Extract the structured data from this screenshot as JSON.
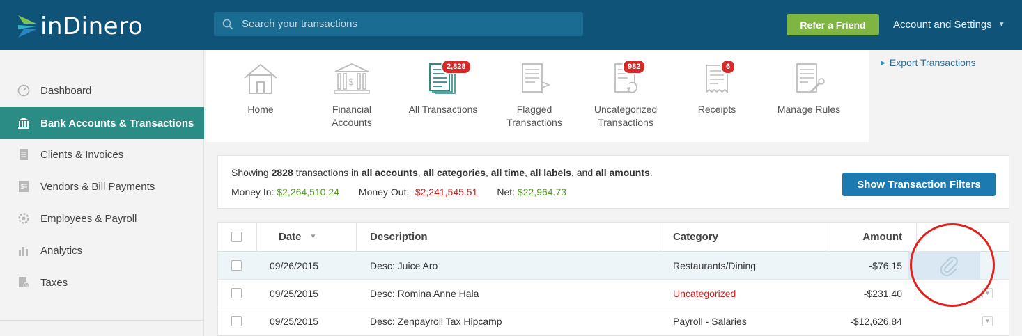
{
  "app": {
    "logo_text": "inDinero",
    "search_placeholder": "Search your transactions",
    "refer_button": "Refer a Friend",
    "account_menu": "Account and Settings",
    "brand_color": "#0f5478",
    "accent_green": "#7fb542"
  },
  "sidebar": {
    "items": [
      {
        "label": "Dashboard",
        "icon": "gauge-icon",
        "active": false
      },
      {
        "label": "Bank Accounts & Transactions",
        "icon": "bank-icon",
        "active": true
      },
      {
        "label": "Clients & Invoices",
        "icon": "invoice-icon",
        "active": false
      },
      {
        "label": "Vendors & Bill Payments",
        "icon": "bill-icon",
        "active": false
      },
      {
        "label": "Employees & Payroll",
        "icon": "payroll-icon",
        "active": false
      },
      {
        "label": "Analytics",
        "icon": "bar-chart-icon",
        "active": false
      },
      {
        "label": "Taxes",
        "icon": "taxes-icon",
        "active": false
      }
    ]
  },
  "nav": {
    "tiles": [
      {
        "label_1": "Home",
        "label_2": "",
        "icon": "home-icon",
        "badge": ""
      },
      {
        "label_1": "Financial",
        "label_2": "Accounts",
        "icon": "bank-building-icon",
        "badge": ""
      },
      {
        "label_1": "All Transactions",
        "label_2": "",
        "icon": "documents-stack-icon",
        "badge": "2,828"
      },
      {
        "label_1": "Flagged",
        "label_2": "Transactions",
        "icon": "flagged-document-icon",
        "badge": ""
      },
      {
        "label_1": "Uncategorized",
        "label_2": "Transactions",
        "icon": "uncategorized-document-icon",
        "badge": "982"
      },
      {
        "label_1": "Receipts",
        "label_2": "",
        "icon": "receipt-icon",
        "badge": "6"
      },
      {
        "label_1": "Manage Rules",
        "label_2": "",
        "icon": "rules-document-icon",
        "badge": ""
      }
    ],
    "export_link": "Export Transactions"
  },
  "summary": {
    "showing_prefix": "Showing ",
    "count": "2828",
    "text_in": " transactions in ",
    "accounts": "all accounts",
    "categories": "all categories",
    "time": "all time",
    "labels": "all labels",
    "and": ", and ",
    "amounts": "all amounts",
    "period": ".",
    "money_in_label": "Money In: ",
    "money_in": "$2,264,510.24",
    "money_out_label": "Money Out: ",
    "money_out": "-$2,241,545.51",
    "net_label": "Net: ",
    "net": "$22,964.73",
    "filters_button": "Show Transaction Filters"
  },
  "table": {
    "headers": {
      "date": "Date",
      "description": "Description",
      "category": "Category",
      "amount": "Amount"
    },
    "rows": [
      {
        "date": "09/26/2015",
        "description": "Desc: Juice Aro",
        "category": "Restaurants/Dining",
        "amount": "-$76.15",
        "uncategorized": false
      },
      {
        "date": "09/25/2015",
        "description": "Desc: Romina Anne Hala",
        "category": "Uncategorized",
        "amount": "-$231.40",
        "uncategorized": true
      },
      {
        "date": "09/25/2015",
        "description": "Desc: Zenpayroll Tax Hipcamp",
        "category": "Payroll - Salaries",
        "amount": "-$12,626.84",
        "uncategorized": false
      }
    ]
  }
}
